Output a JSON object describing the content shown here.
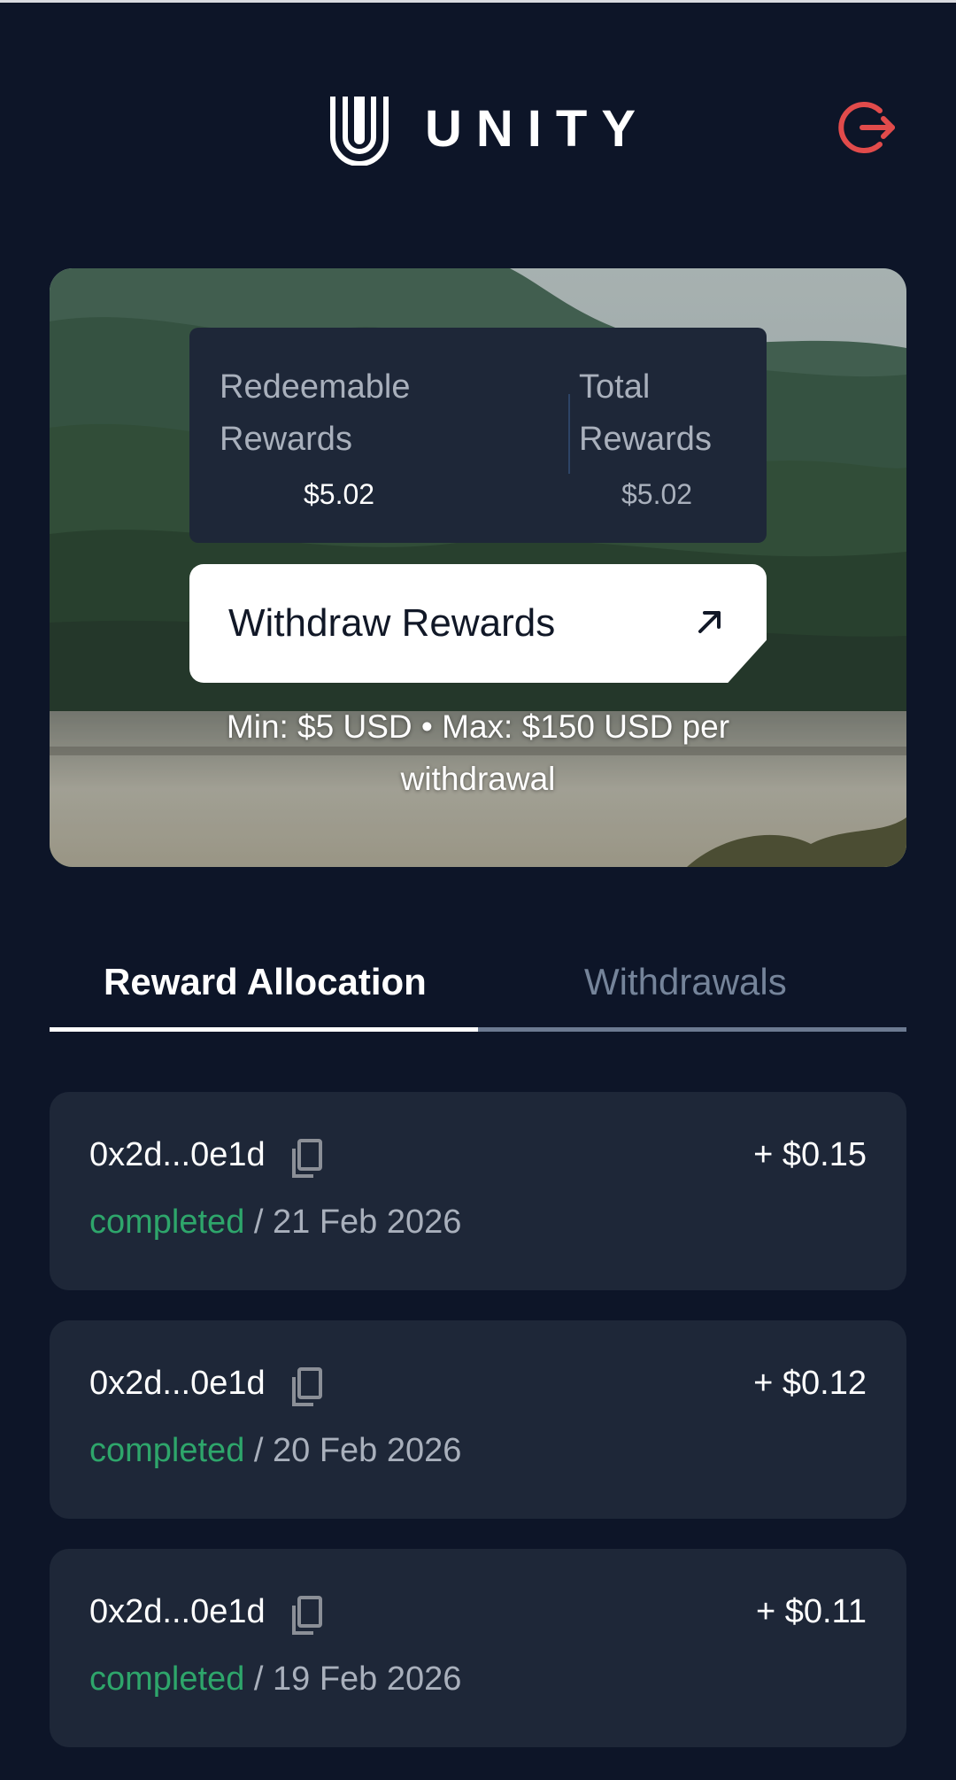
{
  "header": {
    "brand": "UNITY",
    "logout_icon": "logout-icon",
    "logout_color": "#e14b4b"
  },
  "hero": {
    "redeemable_label": "Redeemable Rewards",
    "redeemable_value": "$5.02",
    "total_label": "Total Rewards",
    "total_value": "$5.02",
    "withdraw_label": "Withdraw Rewards",
    "withdraw_icon": "arrow-up-right-icon",
    "limits_text": "Min: $5 USD • Max: $150 USD per withdrawal"
  },
  "tabs": [
    {
      "label": "Reward Allocation",
      "active": true
    },
    {
      "label": "Withdrawals",
      "active": false
    }
  ],
  "transactions": [
    {
      "address": "0x2d...0e1d",
      "amount": "+ $0.15",
      "status": "completed",
      "date": " / 21 Feb 2026"
    },
    {
      "address": "0x2d...0e1d",
      "amount": "+ $0.12",
      "status": "completed",
      "date": " / 20 Feb 2026"
    },
    {
      "address": "0x2d...0e1d",
      "amount": "+ $0.11",
      "status": "completed",
      "date": " / 19 Feb 2026"
    }
  ],
  "colors": {
    "background": "#0d1528",
    "card": "#1e2738",
    "status_completed": "#2ea66b",
    "muted_text": "#a9b0bc"
  }
}
